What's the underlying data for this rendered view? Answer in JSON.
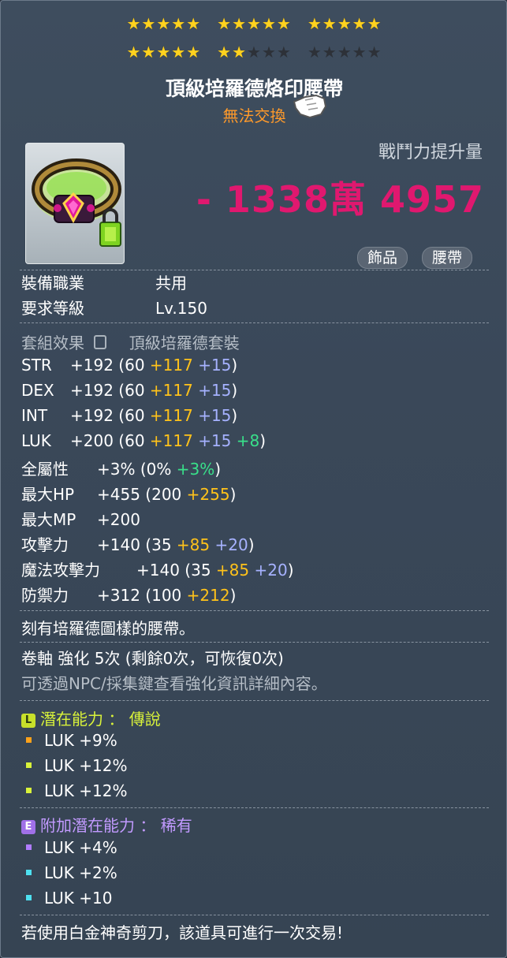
{
  "stars": {
    "groups": [
      {
        "on": 5,
        "off": 0
      },
      {
        "on": 5,
        "off": 0
      },
      {
        "on": 5,
        "off": 0
      },
      {
        "on": 5,
        "off": 0
      },
      {
        "on": 2,
        "off": 3
      },
      {
        "on": 0,
        "off": 5
      }
    ]
  },
  "item": {
    "name": "頂級培羅德烙印腰帶",
    "trade_status": "無法交換",
    "icon": "pink-gem-belt-icon"
  },
  "combat": {
    "label": "戰鬥力提升量",
    "value": "- 1338萬 4957"
  },
  "tags": [
    "飾品",
    "腰帶"
  ],
  "requirements": [
    {
      "key": "裝備職業",
      "value": "共用"
    },
    {
      "key": "要求等級",
      "value": "Lv.150"
    }
  ],
  "set": {
    "key": "套組效果",
    "value": "頂級培羅德套裝",
    "icon": "lock-icon"
  },
  "stats": [
    {
      "key": "STR",
      "total": "+192",
      "parts": [
        {
          "t": "(60 ",
          "c": ""
        },
        {
          "t": "+117",
          "c": "y"
        },
        {
          "t": " +15",
          "c": "b"
        },
        {
          "t": ")",
          "c": ""
        }
      ]
    },
    {
      "key": "DEX",
      "total": "+192",
      "parts": [
        {
          "t": "(60 ",
          "c": ""
        },
        {
          "t": "+117",
          "c": "y"
        },
        {
          "t": " +15",
          "c": "b"
        },
        {
          "t": ")",
          "c": ""
        }
      ]
    },
    {
      "key": "INT",
      "total": "+192",
      "parts": [
        {
          "t": "(60 ",
          "c": ""
        },
        {
          "t": "+117",
          "c": "y"
        },
        {
          "t": " +15",
          "c": "b"
        },
        {
          "t": ")",
          "c": ""
        }
      ]
    },
    {
      "key": "LUK",
      "total": "+200",
      "parts": [
        {
          "t": "(60 ",
          "c": ""
        },
        {
          "t": "+117",
          "c": "y"
        },
        {
          "t": " +15",
          "c": "b"
        },
        {
          "t": " +8",
          "c": "g"
        },
        {
          "t": ")",
          "c": ""
        }
      ]
    },
    {
      "key": "全屬性",
      "total": "+3%",
      "parts": [
        {
          "t": "(0% ",
          "c": ""
        },
        {
          "t": "+3%",
          "c": "g"
        },
        {
          "t": ")",
          "c": ""
        }
      ]
    },
    {
      "key": "最大HP",
      "total": "+455",
      "parts": [
        {
          "t": "(200 ",
          "c": ""
        },
        {
          "t": "+255",
          "c": "y"
        },
        {
          "t": ")",
          "c": ""
        }
      ]
    },
    {
      "key": "最大MP",
      "total": "+200",
      "parts": []
    },
    {
      "key": "攻擊力",
      "total": "+140",
      "parts": [
        {
          "t": "(35 ",
          "c": ""
        },
        {
          "t": "+85",
          "c": "y"
        },
        {
          "t": " +20",
          "c": "b"
        },
        {
          "t": ")",
          "c": ""
        }
      ]
    },
    {
      "key": "魔法攻擊力",
      "total": "+140",
      "parts": [
        {
          "t": "(35 ",
          "c": ""
        },
        {
          "t": "+85",
          "c": "y"
        },
        {
          "t": " +20",
          "c": "b"
        },
        {
          "t": ")",
          "c": ""
        }
      ]
    },
    {
      "key": "防禦力",
      "total": "+312",
      "parts": [
        {
          "t": "(100 ",
          "c": ""
        },
        {
          "t": "+212",
          "c": "y"
        },
        {
          "t": ")",
          "c": ""
        }
      ]
    }
  ],
  "description": "刻有培羅德圖樣的腰帶。",
  "scroll": "卷軸 強化 5次 (剩餘0次，可恢復0次)",
  "scroll_hint": "可透過NPC/採集鍵查看強化資訊詳細內容。",
  "potential": {
    "badge": "L",
    "title": "潛在能力 ： 傳說",
    "color": "#d9f23a",
    "lines": [
      {
        "text": "LUK +9%",
        "dot": "#ffa21a"
      },
      {
        "text": "LUK +12%",
        "dot": "#d9f23a"
      },
      {
        "text": "LUK +12%",
        "dot": "#d9f23a"
      }
    ]
  },
  "bonus_potential": {
    "badge": "E",
    "title": "附加潛在能力 ： 稀有",
    "color": "#c29aff",
    "lines": [
      {
        "text": "LUK +4%",
        "dot": "#b07cff"
      },
      {
        "text": "LUK +2%",
        "dot": "#4ee0f0"
      },
      {
        "text": "LUK +10",
        "dot": "#4ee0f0"
      }
    ]
  },
  "footer": "若使用白金神奇剪刀，該道具可進行一次交易!"
}
